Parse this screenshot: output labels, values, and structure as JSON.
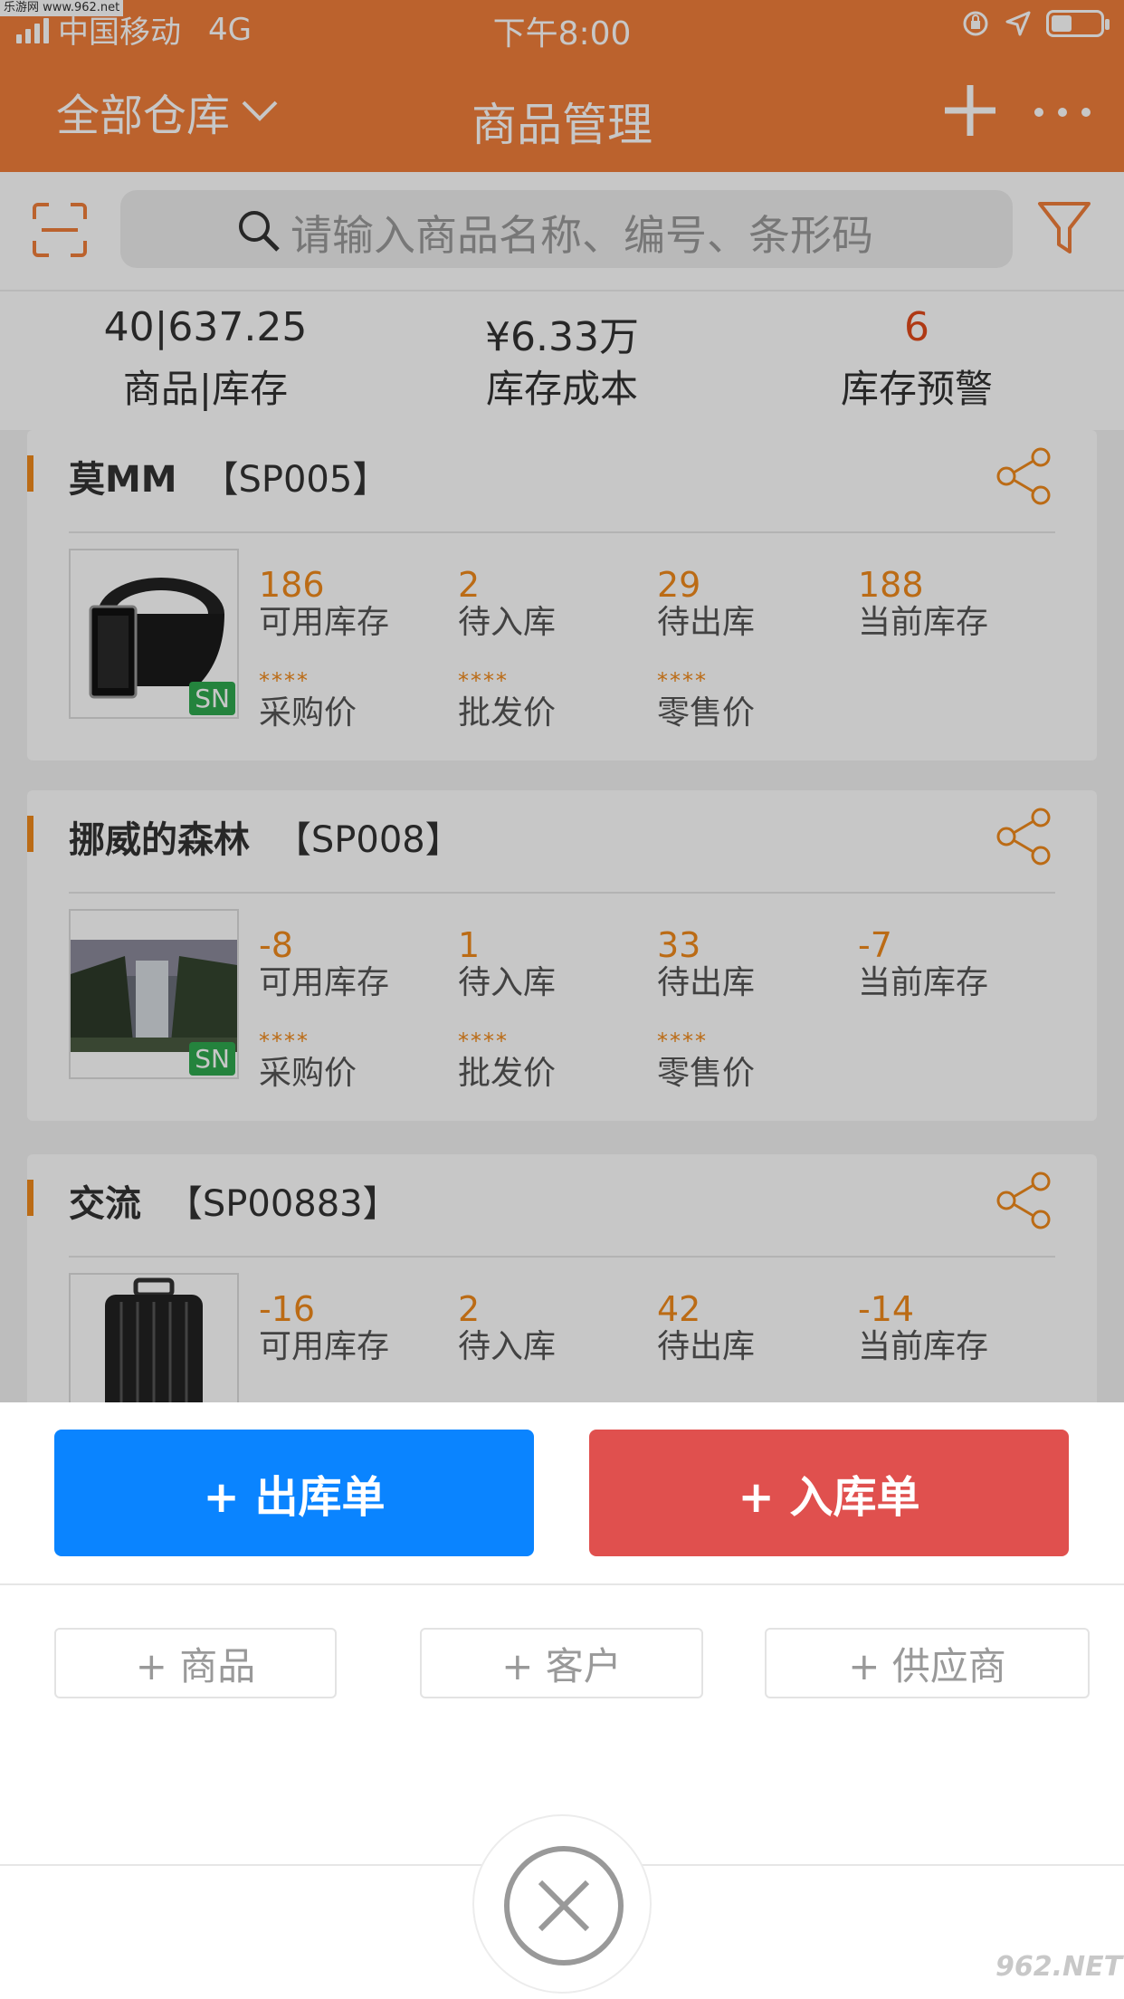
{
  "status_bar": {
    "carrier": "中国移动",
    "network": "4G",
    "time": "下午8:00",
    "watermark": "乐游网 www.962.net"
  },
  "nav": {
    "warehouse": "全部仓库",
    "title": "商品管理"
  },
  "search": {
    "placeholder": "请输入商品名称、编号、条形码"
  },
  "summary": [
    {
      "value": "40|637.25",
      "label": "商品|库存"
    },
    {
      "value": "¥6.33万",
      "label": "库存成本"
    },
    {
      "value": "6",
      "label": "库存预警"
    }
  ],
  "labels": {
    "available": "可用库存",
    "incoming": "待入库",
    "outgoing": "待出库",
    "current": "当前库存",
    "purchase": "采购价",
    "wholesale": "批发价",
    "retail": "零售价",
    "masked": "****",
    "sn": "SN"
  },
  "products": [
    {
      "name": "莫MM",
      "code": "【SP005】",
      "available": "186",
      "incoming": "2",
      "outgoing": "29",
      "current": "188",
      "image": "belt"
    },
    {
      "name": "挪威的森林",
      "code": "【SP008】",
      "available": "-8",
      "incoming": "1",
      "outgoing": "33",
      "current": "-7",
      "image": "waterfall"
    },
    {
      "name": "交流",
      "code": "【SP00883】",
      "available": "-16",
      "incoming": "2",
      "outgoing": "42",
      "current": "-14",
      "image": "suitcase"
    }
  ],
  "sheet": {
    "outbound": "+ 出库单",
    "inbound": "+ 入库单",
    "add_product": "+ 商品",
    "add_customer": "+ 客户",
    "add_supplier": "+ 供应商"
  },
  "watermark_bottom": "962.NET",
  "colors": {
    "primary": "#f07e3a",
    "accent_text": "#f08a1c",
    "warning": "#e04a1a",
    "outbound_btn": "#0a84ff",
    "inbound_btn": "#e0504e"
  }
}
